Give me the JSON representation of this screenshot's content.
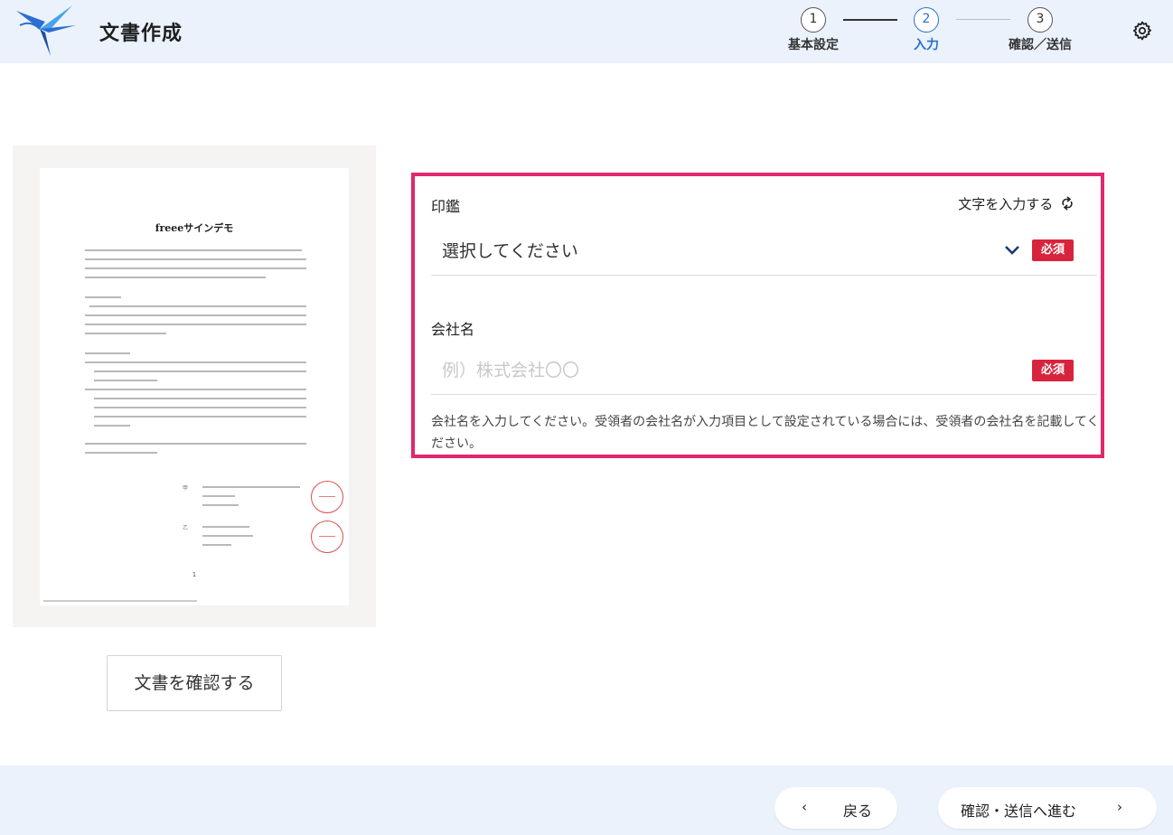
{
  "app": {
    "title": "文書作成"
  },
  "stepper": {
    "steps": [
      {
        "number": "1",
        "label": "基本設定"
      },
      {
        "number": "2",
        "label": "入力"
      },
      {
        "number": "3",
        "label": "確認／送信"
      }
    ],
    "active_step": 2
  },
  "preview": {
    "document_title": "freeeサインデモ",
    "page_number": "1",
    "party_a": "甲",
    "party_b": "乙",
    "confirm_button": "文書を確認する"
  },
  "form": {
    "seal": {
      "label": "印鑑",
      "toggle_text": "文字を入力する",
      "selected": "選択してください",
      "required_badge": "必須"
    },
    "company": {
      "label": "会社名",
      "placeholder": "例）株式会社〇〇",
      "value": "",
      "required_badge": "必須",
      "help": "会社名を入力してください。受領者の会社名が入力項目として設定されている場合には、受領者の会社名を記載してください。"
    }
  },
  "footer": {
    "back_label": "戻る",
    "next_label": "確認・送信へ進む"
  },
  "colors": {
    "accent_highlight": "#e2276e",
    "required_badge": "#d7243c",
    "step_active": "#2a6fd1",
    "header_bg": "#ebf2fb"
  }
}
